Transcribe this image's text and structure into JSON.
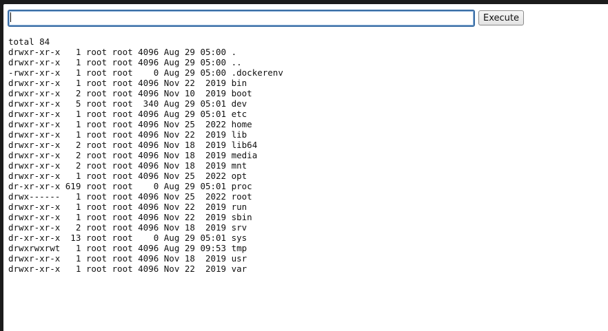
{
  "command_bar": {
    "input_value": "",
    "input_placeholder": "",
    "execute_label": "Execute"
  },
  "output": {
    "lines": [
      "total 84",
      "drwxr-xr-x   1 root root 4096 Aug 29 05:00 .",
      "drwxr-xr-x   1 root root 4096 Aug 29 05:00 ..",
      "-rwxr-xr-x   1 root root    0 Aug 29 05:00 .dockerenv",
      "drwxr-xr-x   1 root root 4096 Nov 22  2019 bin",
      "drwxr-xr-x   2 root root 4096 Nov 10  2019 boot",
      "drwxr-xr-x   5 root root  340 Aug 29 05:01 dev",
      "drwxr-xr-x   1 root root 4096 Aug 29 05:01 etc",
      "drwxr-xr-x   1 root root 4096 Nov 25  2022 home",
      "drwxr-xr-x   1 root root 4096 Nov 22  2019 lib",
      "drwxr-xr-x   2 root root 4096 Nov 18  2019 lib64",
      "drwxr-xr-x   2 root root 4096 Nov 18  2019 media",
      "drwxr-xr-x   2 root root 4096 Nov 18  2019 mnt",
      "drwxr-xr-x   1 root root 4096 Nov 25  2022 opt",
      "dr-xr-xr-x 619 root root    0 Aug 29 05:01 proc",
      "drwx------   1 root root 4096 Nov 25  2022 root",
      "drwxr-xr-x   1 root root 4096 Nov 22  2019 run",
      "drwxr-xr-x   1 root root 4096 Nov 22  2019 sbin",
      "drwxr-xr-x   2 root root 4096 Nov 18  2019 srv",
      "dr-xr-xr-x  13 root root    0 Aug 29 05:01 sys",
      "drwxrwxrwt   1 root root 4096 Aug 29 09:53 tmp",
      "drwxr-xr-x   1 root root 4096 Nov 18  2019 usr",
      "drwxr-xr-x   1 root root 4096 Nov 22  2019 var"
    ]
  }
}
